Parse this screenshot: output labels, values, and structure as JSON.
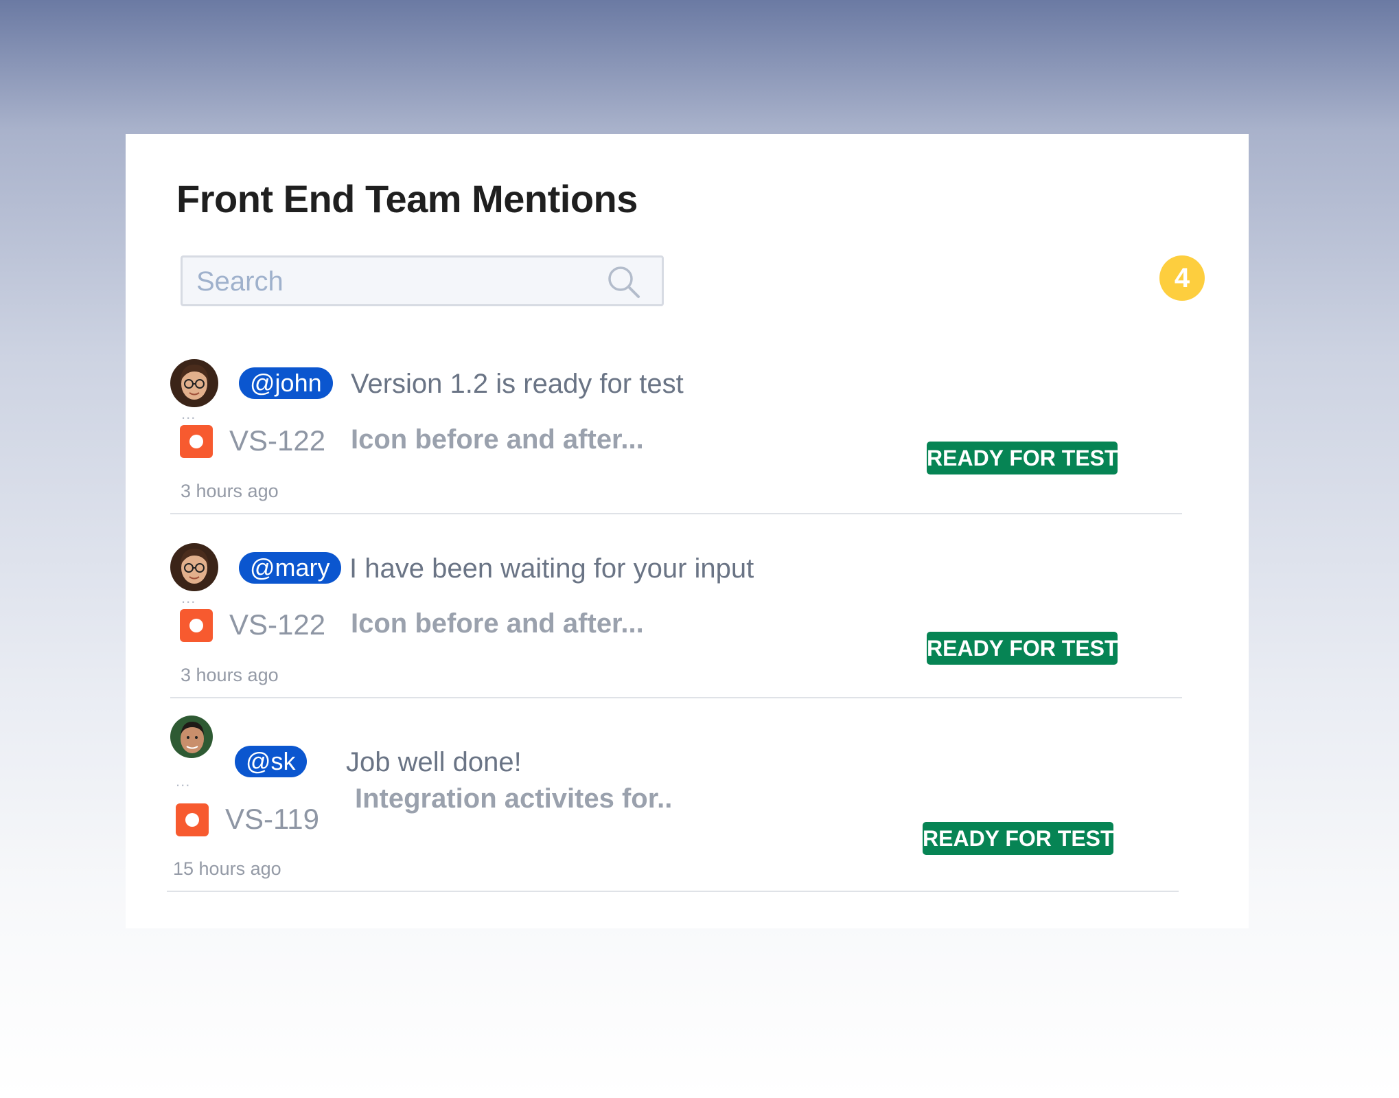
{
  "widget": {
    "title": "Front End Team Mentions",
    "search": {
      "placeholder": "Search",
      "value": ""
    },
    "mention_count": "4"
  },
  "mentions": [
    {
      "user": "@john",
      "message": "Version 1.2 is ready for test",
      "issue_key": "VS-122",
      "issue_summary": "Icon before and after...",
      "status": "READY FOR TEST",
      "time": "3 hours ago",
      "more": "..."
    },
    {
      "user": "@mary",
      "message": "I have  been waiting for your input",
      "issue_key": "VS-122",
      "issue_summary": "Icon before and after...",
      "status": "READY FOR TEST",
      "time": "3 hours ago",
      "more": "..."
    },
    {
      "user": "@sk",
      "message": "Job well done!",
      "issue_key": "VS-119",
      "issue_summary": "Integration activites for..",
      "status": "READY FOR TEST",
      "time": "15 hours ago",
      "more": "..."
    }
  ],
  "colors": {
    "mention_tag": "#0b56cf",
    "status_badge": "#068454",
    "issue_icon": "#f75a2f",
    "count_badge": "#fdce3e"
  },
  "icons": {
    "search": "search-icon",
    "issue_type": "issue-type-icon",
    "avatar": "avatar"
  }
}
